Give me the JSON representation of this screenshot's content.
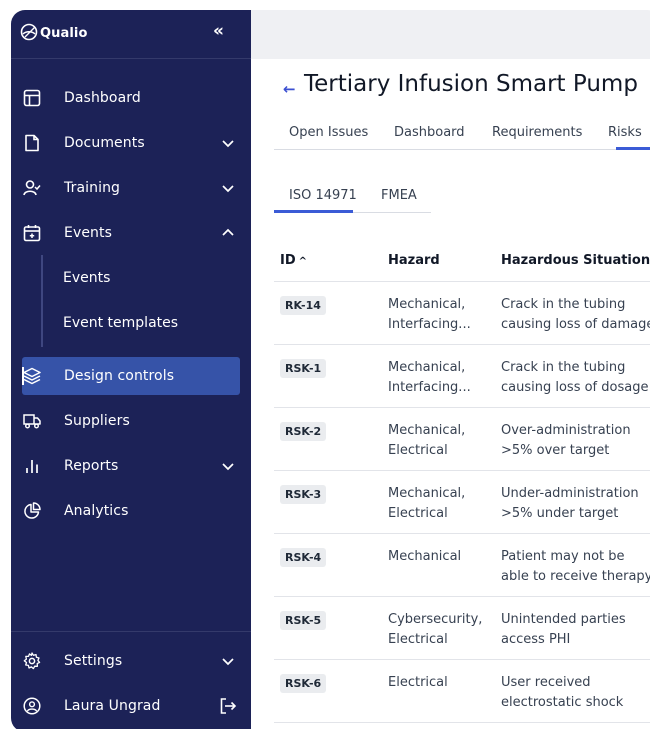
{
  "sidebar": {
    "brand": "Qualio",
    "collapse_glyph": "«",
    "items": [
      {
        "label": "Dashboard",
        "icon": "layout-icon"
      },
      {
        "label": "Documents",
        "icon": "document-icon",
        "expandable": true
      },
      {
        "label": "Training",
        "icon": "user-check-icon",
        "expandable": true
      },
      {
        "label": "Events",
        "icon": "calendar-icon",
        "expanded": true
      },
      {
        "label": "Design controls",
        "icon": "layers-icon",
        "active": true
      },
      {
        "label": "Suppliers",
        "icon": "truck-icon"
      },
      {
        "label": "Reports",
        "icon": "bar-chart-icon",
        "expandable": true
      },
      {
        "label": "Analytics",
        "icon": "pie-chart-icon"
      }
    ],
    "event_subitems": [
      "Events",
      "Event templates"
    ],
    "settings": "Settings",
    "user": "Laura Ungrad"
  },
  "header": {
    "back_glyph": "←",
    "title": "Tertiary Infusion Smart Pump",
    "tabs": [
      "Open Issues",
      "Dashboard",
      "Requirements",
      "Risks"
    ],
    "active_tab": "Risks"
  },
  "subtabs": {
    "items": [
      "ISO 14971",
      "FMEA"
    ],
    "active": "ISO 14971"
  },
  "table": {
    "columns": [
      "ID",
      "Hazard",
      "Hazardous Situation"
    ],
    "sort_glyph": "^",
    "rows": [
      {
        "id": "RK-14",
        "hazard": "Mechanical,\nInterfacing...",
        "situation": "Crack in the tubing\ncausing loss of damage"
      },
      {
        "id": "RSK-1",
        "hazard": "Mechanical,\nInterfacing...",
        "situation": "Crack in the tubing\ncausing loss of dosage"
      },
      {
        "id": "RSK-2",
        "hazard": "Mechanical,\nElectrical",
        "situation": "Over-administration\n>5% over target"
      },
      {
        "id": "RSK-3",
        "hazard": "Mechanical,\nElectrical",
        "situation": "Under-administration\n>5% under target"
      },
      {
        "id": "RSK-4",
        "hazard": "Mechanical",
        "situation": "Patient may not be\nable to receive therapy"
      },
      {
        "id": "RSK-5",
        "hazard": "Cybersecurity,\nElectrical",
        "situation": "Unintended parties\naccess PHI"
      },
      {
        "id": "RSK-6",
        "hazard": "Electrical",
        "situation": "User received\nelectrostatic shock"
      }
    ]
  },
  "colors": {
    "sidebar_bg": "#1c2257",
    "active_item_bg": "#3653a8",
    "accent": "#3b5bd6",
    "topbar_bg": "#eff0f3"
  }
}
